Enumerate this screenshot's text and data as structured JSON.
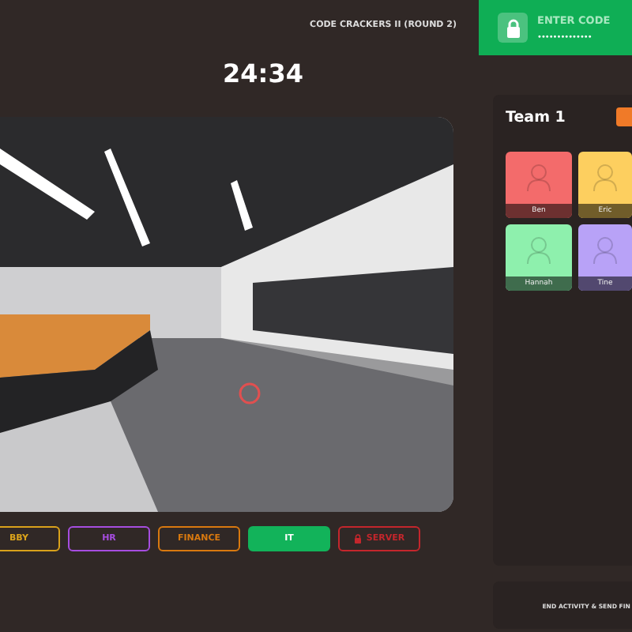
{
  "header": {
    "title": "CODE CRACKERS II (ROUND 2)",
    "timer": "24:34"
  },
  "code_entry": {
    "label": "ENTER CODE",
    "value": "••••••••••••••"
  },
  "rooms": [
    {
      "label": "BBY",
      "color": "#d9a21b",
      "selected": false,
      "locked": false
    },
    {
      "label": "HR",
      "color": "#a64de0",
      "selected": false,
      "locked": false
    },
    {
      "label": "FINANCE",
      "color": "#d9790f",
      "selected": false,
      "locked": false
    },
    {
      "label": "IT",
      "color": "#12b35a",
      "selected": true,
      "locked": false
    },
    {
      "label": "SERVER",
      "color": "#c4262c",
      "selected": false,
      "locked": true
    }
  ],
  "team": {
    "name": "Team 1",
    "members": [
      {
        "name": "Ben",
        "color": "#f36b6b"
      },
      {
        "name": "Eric",
        "color": "#fdcf5f"
      },
      {
        "name": "Hannah",
        "color": "#8ef0ad"
      },
      {
        "name": "Tine",
        "color": "#b8a2f7"
      }
    ]
  },
  "end_button": "END ACTIVITY & SEND FIN"
}
